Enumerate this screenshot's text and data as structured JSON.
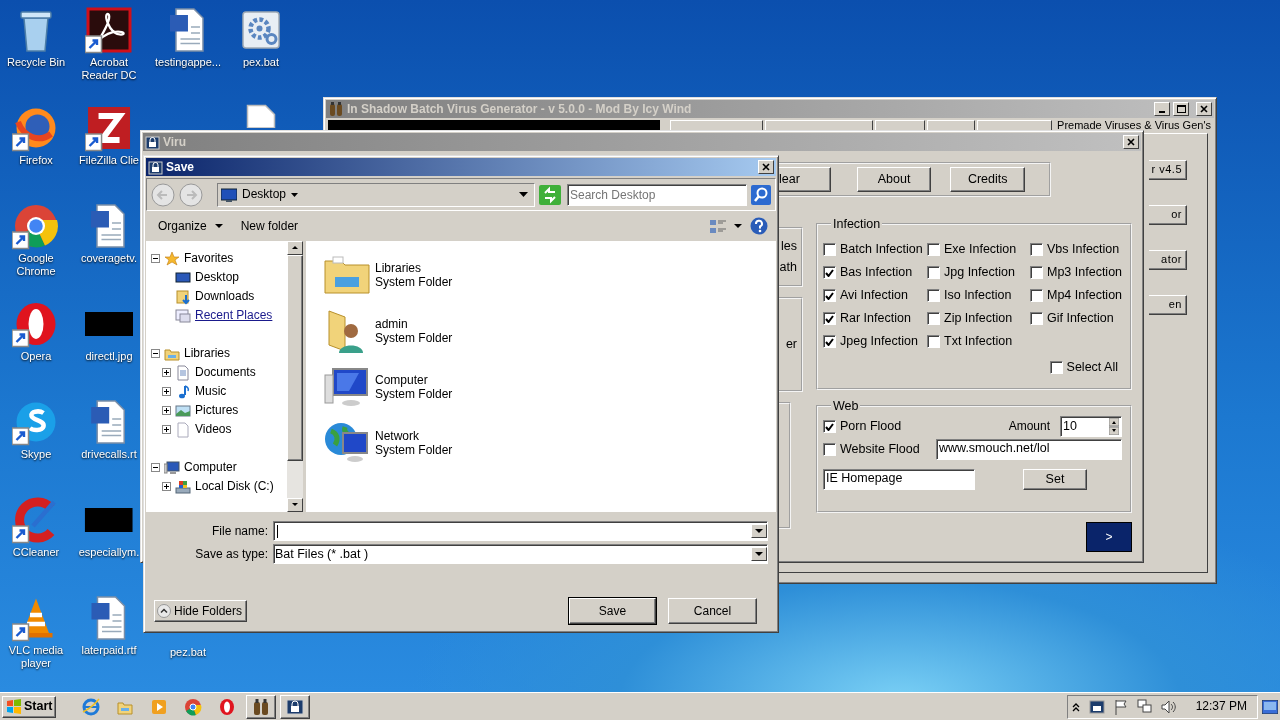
{
  "desktop_icons": [
    {
      "label": "Recycle Bin",
      "kind": "recycle",
      "shortcut": false
    },
    {
      "label": "Acrobat Reader DC",
      "kind": "pdf",
      "shortcut": true
    },
    {
      "label": "testingappe...",
      "kind": "word",
      "shortcut": false
    },
    {
      "label": "pex.bat",
      "kind": "bat",
      "shortcut": false
    },
    {
      "label": "Firefox",
      "kind": "firefox",
      "shortcut": true
    },
    {
      "label": "FileZilla Clie",
      "kind": "filezilla",
      "shortcut": true
    },
    {
      "kind": "blank"
    },
    {
      "label": "Google Chrome",
      "kind": "chrome",
      "shortcut": true
    },
    {
      "label": "coveragetv.",
      "kind": "word",
      "shortcut": false
    },
    {
      "label": "Opera",
      "kind": "opera",
      "shortcut": true
    },
    {
      "label": "directl.jpg",
      "kind": "black",
      "shortcut": false
    },
    {
      "label": "Skype",
      "kind": "skype",
      "shortcut": true
    },
    {
      "label": "drivecalls.rt",
      "kind": "word",
      "shortcut": false
    },
    {
      "label": "CCleaner",
      "kind": "ccleaner",
      "shortcut": true
    },
    {
      "label": "especiallym.",
      "kind": "black",
      "shortcut": false
    },
    {
      "label": "VLC media player",
      "kind": "vlc",
      "shortcut": true
    },
    {
      "label": "laterpaid.rtf",
      "kind": "word",
      "shortcut": false
    },
    {
      "label": "pez.bat"
    }
  ],
  "generator_window": {
    "title": "In Shadow Batch Virus Generator  -  v 5.0.0  -  Mod By Icy Wind",
    "tabs": [
      {
        "selected": false
      },
      {
        "selected": false
      },
      {
        "selected": false
      },
      {
        "selected": false
      },
      {
        "selected": false
      },
      {
        "label": "Premade Viruses & Virus Gen's",
        "selected": true
      }
    ],
    "side_buttons": [
      "r v4.5",
      "or",
      "ator",
      "en"
    ]
  },
  "viru_window": {
    "title": "Viru",
    "top_buttons": [
      "lear",
      "About",
      "Credits"
    ],
    "side_group_texts": [
      [
        "les",
        "ath"
      ],
      [
        "er"
      ]
    ],
    "infection": {
      "title": "Infection",
      "options": [
        {
          "label": "Batch Infection",
          "checked": false
        },
        {
          "label": "Exe Infection",
          "checked": false
        },
        {
          "label": "Vbs Infection",
          "checked": false
        },
        {
          "label": "Bas Infection",
          "checked": true
        },
        {
          "label": "Jpg Infection",
          "checked": false
        },
        {
          "label": "Mp3 Infection",
          "checked": false
        },
        {
          "label": "Avi Infection",
          "checked": true
        },
        {
          "label": "Iso Infection",
          "checked": false
        },
        {
          "label": "Mp4 Infection",
          "checked": false
        },
        {
          "label": "Rar Infection",
          "checked": true
        },
        {
          "label": "Zip Infection",
          "checked": false
        },
        {
          "label": "Gif Infection",
          "checked": false
        },
        {
          "label": "Jpeg Infection",
          "checked": true
        },
        {
          "label": "Txt Infection",
          "checked": false
        }
      ],
      "select_all": {
        "label": "Select All",
        "checked": false
      }
    },
    "web": {
      "title": "Web",
      "floods": [
        {
          "label": "Porn Flood",
          "checked": true
        },
        {
          "label": "Website Flood",
          "checked": false
        }
      ],
      "amount_label": "Amount",
      "amount": "10",
      "url": "www.smouch.net/lol",
      "homepage": "IE Homepage",
      "set_button": "Set"
    },
    "next_button": ">"
  },
  "save_dialog": {
    "title": "Save",
    "location": "Desktop",
    "search": {
      "placeholder": "Search Desktop"
    },
    "toolbar": {
      "organize": "Organize",
      "new_folder": "New folder"
    },
    "tree": [
      {
        "label": "Favorites",
        "kind": "star",
        "expanded": true,
        "children": [
          {
            "label": "Desktop",
            "kind": "desktop",
            "hover": false
          },
          {
            "label": "Downloads",
            "kind": "downloads",
            "hover": false
          },
          {
            "label": "Recent Places",
            "kind": "recent",
            "hover": true
          }
        ]
      },
      {
        "label": "Libraries",
        "kind": "library",
        "expanded": true,
        "children": [
          {
            "label": "Documents",
            "kind": "documents",
            "expanded": false
          },
          {
            "label": "Music",
            "kind": "music",
            "expanded": false
          },
          {
            "label": "Pictures",
            "kind": "pictures",
            "expanded": false
          },
          {
            "label": "Videos",
            "kind": "videos",
            "expanded": false
          }
        ]
      },
      {
        "label": "Computer",
        "kind": "computer",
        "expanded": true,
        "children": [
          {
            "label": "Local Disk (C:)",
            "kind": "disk",
            "expanded": false
          }
        ]
      }
    ],
    "items": [
      {
        "name": "Libraries",
        "type": "System Folder",
        "kind": "library"
      },
      {
        "name": "admin",
        "type": "System Folder",
        "kind": "user"
      },
      {
        "name": "Computer",
        "type": "System Folder",
        "kind": "computer"
      },
      {
        "name": "Network",
        "type": "System Folder",
        "kind": "network"
      }
    ],
    "file_name": {
      "label": "File name:",
      "focused": true
    },
    "save_type": {
      "label": "Save as type:",
      "value": "Bat Files (* .bat )"
    },
    "hide_folders": "Hide Folders",
    "save_button": "Save",
    "cancel_button": "Cancel"
  },
  "taskbar": {
    "start": "Start",
    "items": [
      {
        "kind": "ie",
        "running": false
      },
      {
        "kind": "explorer",
        "running": false
      },
      {
        "kind": "media",
        "running": false
      },
      {
        "kind": "chrome",
        "running": false
      },
      {
        "kind": "opera",
        "running": false
      },
      {
        "kind": "generator",
        "running": true
      },
      {
        "kind": "viru",
        "running": true
      }
    ],
    "clock": "12:37 PM"
  }
}
